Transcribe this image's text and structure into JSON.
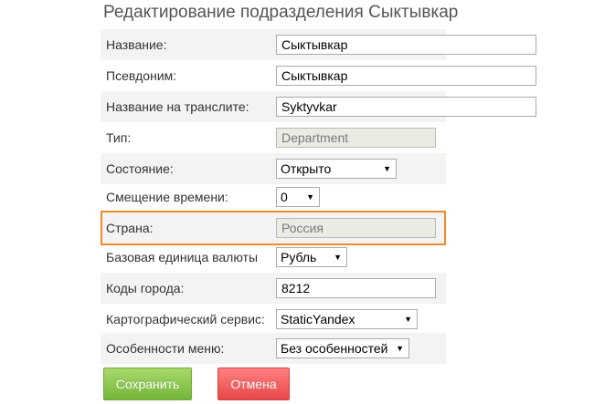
{
  "page": {
    "title": "Редактирование подразделения Сыктывкар"
  },
  "fields": {
    "name": {
      "label": "Название:",
      "value": "Сыктывкар"
    },
    "alias": {
      "label": "Псевдоним:",
      "value": "Сыктывкар"
    },
    "translit": {
      "label": "Название на транслите:",
      "value": "Syktyvkar"
    },
    "type": {
      "label": "Тип:",
      "value": "Department"
    },
    "state": {
      "label": "Состояние:",
      "value": "Открыто"
    },
    "time_offset": {
      "label": "Смещение времени:",
      "value": "0"
    },
    "country": {
      "label": "Страна:",
      "value": "Россия"
    },
    "currency": {
      "label": "Базовая единица валюты",
      "value": "Рубль"
    },
    "city_codes": {
      "label": "Коды города:",
      "value": "8212"
    },
    "map_service": {
      "label": "Картографический сервис:",
      "value": "StaticYandex"
    },
    "menu_features": {
      "label": "Особенности меню:",
      "value": "Без особенностей"
    }
  },
  "icons": {
    "dropdown_arrow": "▼"
  },
  "buttons": {
    "save": "Сохранить",
    "cancel": "Отмена"
  },
  "colors": {
    "highlight": "#f08a2a",
    "save_button": "#8cc751",
    "cancel_button": "#f26363"
  }
}
